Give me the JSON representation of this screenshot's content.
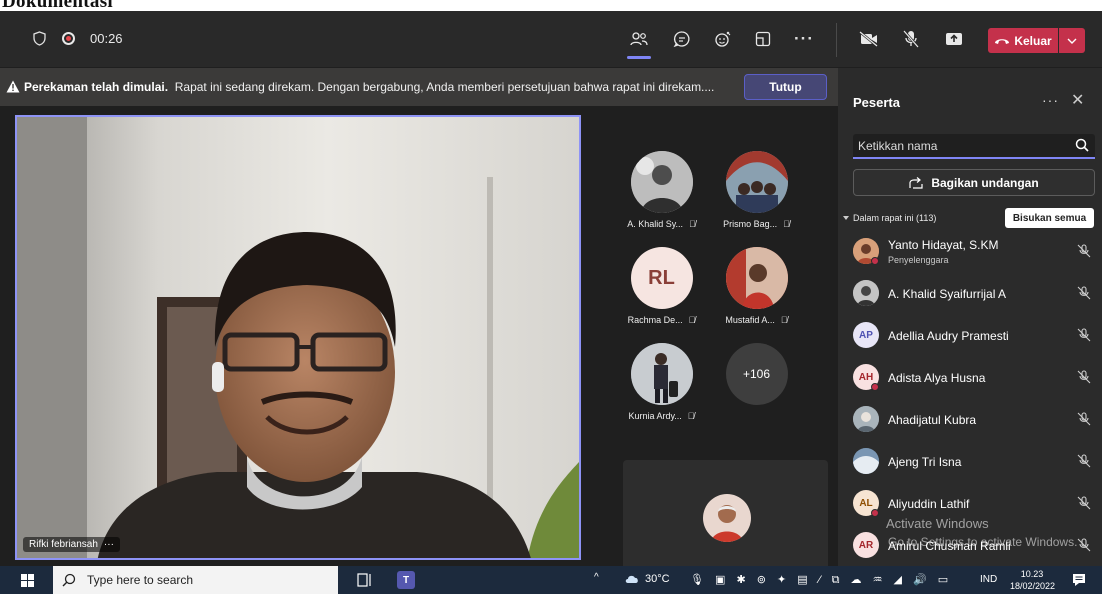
{
  "doc_heading": "Dokumentasi",
  "topbar": {
    "timer": "00:26",
    "leave_label": "Keluar",
    "icons": [
      "shield-icon",
      "record-icon",
      "people-icon",
      "chat-icon",
      "raise-hand-icon",
      "rooms-icon",
      "more-icon",
      "camera-off-icon",
      "mic-off-icon",
      "share-icon",
      "phone-icon"
    ]
  },
  "banner": {
    "bold": "Perekaman telah dimulai.",
    "text": "Rapat ini sedang direkam. Dengan bergabung, Anda memberi persetujuan bahwa rapat ini direkam....",
    "close_label": "Tutup"
  },
  "main_video": {
    "name": "Rifki febriansah",
    "more": "···"
  },
  "tiles": [
    {
      "label": "A. Khalid Sy...",
      "type": "photo",
      "color": "#8a8a8a"
    },
    {
      "label": "Prismo Bag...",
      "type": "photo",
      "color": "#7a5a4a"
    },
    {
      "label": "Rachma De...",
      "type": "initials",
      "initials": "RL"
    },
    {
      "label": "Mustafid A...",
      "type": "photo",
      "color": "#c94a3a"
    },
    {
      "label": "Kurnia Ardy...",
      "type": "photo",
      "color": "#6f7a86"
    },
    {
      "label": "",
      "type": "more",
      "initials": "+106"
    }
  ],
  "panel": {
    "title": "Peserta",
    "more": "···",
    "close": "✕",
    "search_placeholder": "Ketikkan nama",
    "share_label": "Bagikan undangan",
    "in_meeting": "Dalam rapat ini (113)",
    "mute_all": "Bisukan semua",
    "participants": [
      {
        "name": "Yanto Hidayat, S.KM",
        "role": "Penyelenggara",
        "initials": "",
        "bg": "#b07a52"
      },
      {
        "name": "A. Khalid Syaifurrijal A",
        "role": "",
        "initials": "",
        "bg": "#9a9a9a"
      },
      {
        "name": "Adellia Audry Pramesti",
        "role": "",
        "initials": "AP",
        "bg": "#e8e6f7",
        "fg": "#4f52b2"
      },
      {
        "name": "Adista Alya Husna",
        "role": "",
        "initials": "AH",
        "bg": "#f9e1e1",
        "fg": "#a4262c"
      },
      {
        "name": "Ahadijatul Kubra",
        "role": "",
        "initials": "",
        "bg": "#7d8a93"
      },
      {
        "name": "Ajeng Tri Isna",
        "role": "",
        "initials": "",
        "bg": "#5d7891"
      },
      {
        "name": "Aliyuddin Lathif",
        "role": "",
        "initials": "AL",
        "bg": "#f7e4d2",
        "fg": "#8f4e00"
      },
      {
        "name": "Amirul Chusman Ramli",
        "role": "",
        "initials": "AR",
        "bg": "#f9e1e1",
        "fg": "#a4262c"
      }
    ]
  },
  "watermark": {
    "line1": "Activate Windows",
    "line2": "Go to Settings to activate Windows."
  },
  "taskbar": {
    "search_placeholder": "Type here to search",
    "teams_badge": "T",
    "weather": "30°C",
    "lang": "IND",
    "time": "10.23",
    "date": "18/02/2022"
  }
}
